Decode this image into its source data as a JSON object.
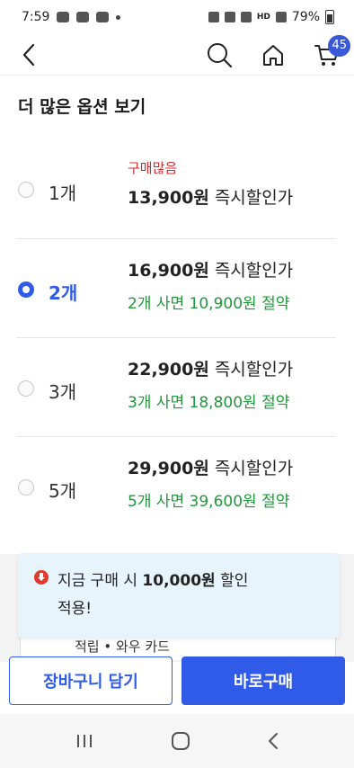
{
  "status_bar": {
    "time": "7:59",
    "battery": "79%",
    "network": "HD"
  },
  "header": {
    "cart_count": "45"
  },
  "section": {
    "title": "더 많은 옵션 보기"
  },
  "options": [
    {
      "qty": "1개",
      "tag": "구매많음",
      "price": "13,900원",
      "price_suffix": "즉시할인가",
      "save": "",
      "selected": false
    },
    {
      "qty": "2개",
      "tag": "",
      "price": "16,900원",
      "price_suffix": "즉시할인가",
      "save": "2개 사면 10,900원 절약",
      "selected": true
    },
    {
      "qty": "3개",
      "tag": "",
      "price": "22,900원",
      "price_suffix": "즉시할인가",
      "save": "3개 사면 18,800원 절약",
      "selected": false
    },
    {
      "qty": "5개",
      "tag": "",
      "price": "29,900원",
      "price_suffix": "즉시할인가",
      "save": "5개 사면 39,600원 절약",
      "selected": false
    }
  ],
  "discount": {
    "prefix": "지금 구매 시",
    "amount": "10,000원",
    "suffix": "할인",
    "line2": "적용!"
  },
  "hidden_card_text": "적립 • 와우 카드",
  "buttons": {
    "cart": "장바구니 담기",
    "buy": "바로구매"
  },
  "colors": {
    "accent": "#2f5be8",
    "save_green": "#1f9a3a",
    "tag_red": "#d32b2b"
  }
}
